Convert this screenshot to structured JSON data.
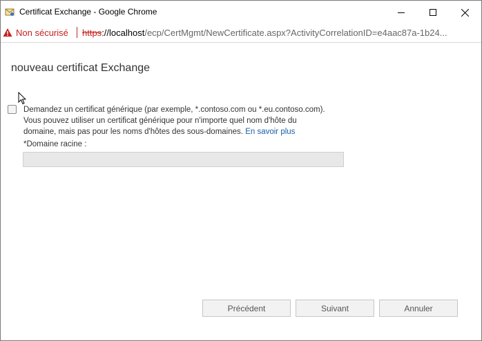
{
  "window": {
    "title": "Certificat Exchange - Google Chrome"
  },
  "address_bar": {
    "security_label": "Non sécurisé",
    "url_scheme": "https",
    "url_host": "://localhost",
    "url_path": "/ecp/CertMgmt/NewCertificate.aspx?ActivityCorrelationID=e4aac87a-1b24..."
  },
  "page": {
    "title": "nouveau certificat Exchange",
    "wildcard_option": {
      "checked": false,
      "line1": "Demandez un certificat générique (par exemple, *.contoso.com ou *.eu.contoso.com).",
      "line2": "Vous pouvez utiliser un certificat générique pour n'importe quel nom d'hôte du",
      "line3": "domaine, mais pas pour les noms d'hôtes des sous-domaines.",
      "learn_more": "En savoir plus"
    },
    "root_domain": {
      "label": "*Domaine racine :",
      "value": ""
    }
  },
  "buttons": {
    "previous": "Précédent",
    "next": "Suivant",
    "cancel": "Annuler"
  },
  "colors": {
    "warning": "#c5221f",
    "link": "#1a5ea8"
  },
  "icons": {
    "app": "certificate-envelope-icon",
    "warning": "warning-triangle-icon",
    "minimize": "minimize-icon",
    "maximize": "maximize-icon",
    "close": "close-icon",
    "cursor": "mouse-pointer-icon"
  }
}
